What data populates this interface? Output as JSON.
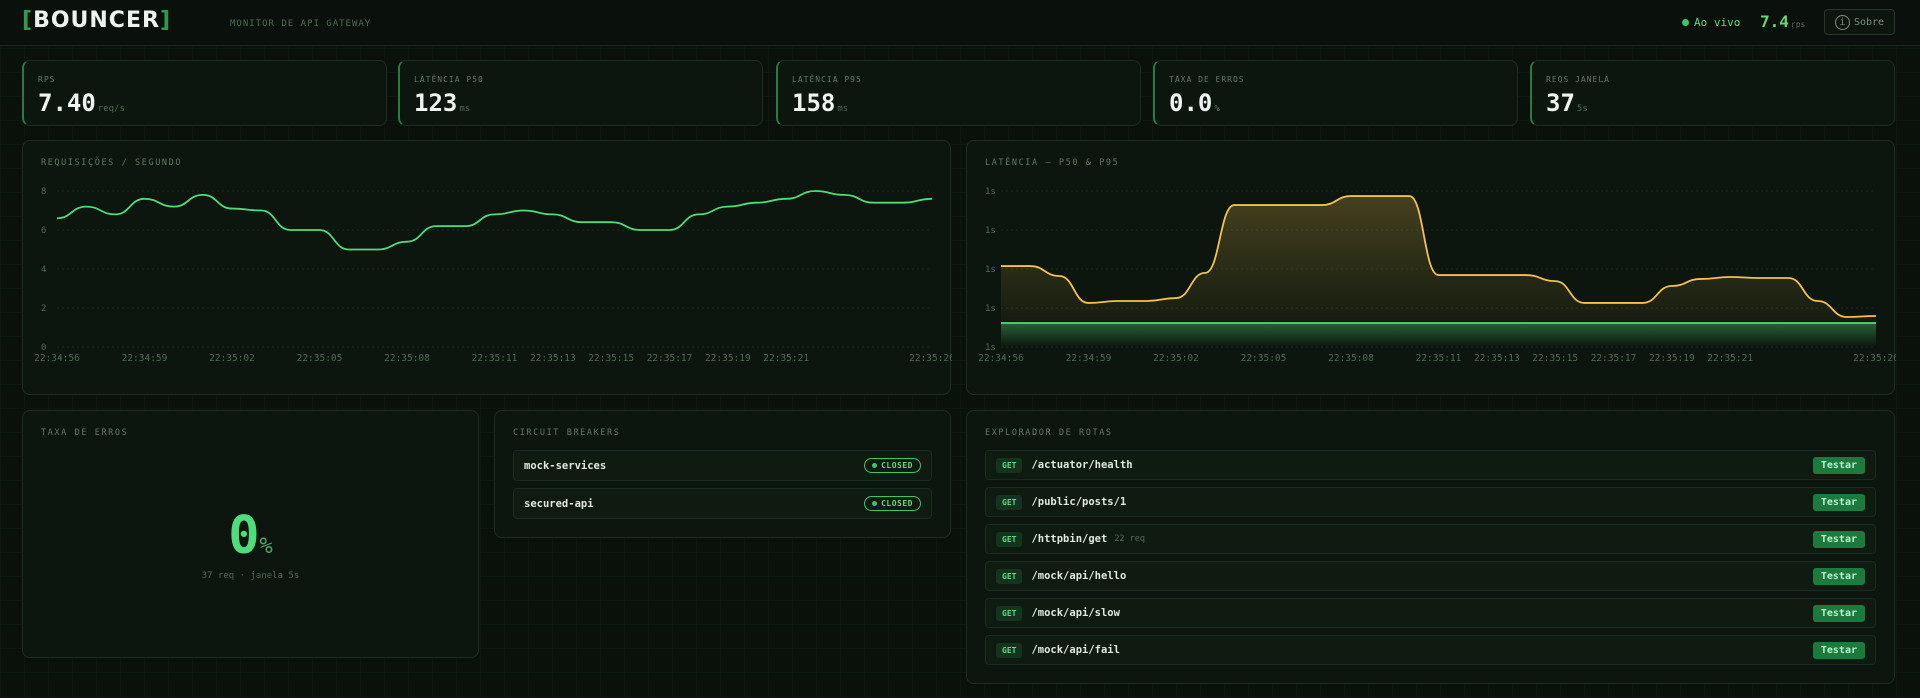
{
  "header": {
    "brand": "BOUNCER",
    "subtitle": "MONITOR DE API GATEWAY",
    "live_label": "Ao vivo",
    "rps_value": "7.4",
    "rps_unit": "rps",
    "about_label": "Sobre"
  },
  "kpis": [
    {
      "label": "RPS",
      "value": "7.40",
      "unit": "req/s"
    },
    {
      "label": "LATÊNCIA P50",
      "value": "123",
      "unit": "ms"
    },
    {
      "label": "LATÊNCIA P95",
      "value": "158",
      "unit": "ms"
    },
    {
      "label": "TAXA DE ERROS",
      "value": "0.0",
      "unit": "%"
    },
    {
      "label": "REQS JANELA",
      "value": "37",
      "unit": "5s"
    }
  ],
  "chart_data": [
    {
      "type": "line",
      "title": "REQUISIÇÕES / SEGUNDO",
      "ylim": [
        0,
        8
      ],
      "yticks": [
        "0",
        "2",
        "4",
        "6",
        "8"
      ],
      "xticks": [
        "22:34:56",
        "22:34:59",
        "22:35:02",
        "22:35:05",
        "22:35:08",
        "22:35:11",
        "22:35:13",
        "22:35:15",
        "22:35:17",
        "22:35:19",
        "22:35:21",
        "22:35:26"
      ],
      "x_start": "22:34:56",
      "x_end": "22:35:26",
      "grid": true,
      "color": "#4fdc7c",
      "values": [
        6.6,
        7.2,
        6.8,
        7.6,
        7.2,
        7.8,
        7.1,
        7.0,
        6.0,
        6.0,
        5.0,
        5.0,
        5.4,
        6.2,
        6.2,
        6.8,
        7.0,
        6.8,
        6.4,
        6.4,
        6.0,
        6.0,
        6.8,
        7.2,
        7.4,
        7.6,
        8.0,
        7.8,
        7.4,
        7.4,
        7.6
      ]
    },
    {
      "type": "area",
      "title": "LATÊNCIA — P50 & P95",
      "ylim": [
        0,
        800
      ],
      "yticks": [
        "1s",
        "1s",
        "1s",
        "1s",
        "1s"
      ],
      "xticks": [
        "22:34:56",
        "22:34:59",
        "22:35:02",
        "22:35:05",
        "22:35:08",
        "22:35:11",
        "22:35:13",
        "22:35:15",
        "22:35:17",
        "22:35:19",
        "22:35:21",
        "22:35:26"
      ],
      "x_start": "22:34:56",
      "x_end": "22:35:26",
      "grid": true,
      "series": [
        {
          "color": "#f2c14e",
          "values": [
            415,
            415,
            364,
            226,
            236,
            236,
            251,
            380,
            728,
            728,
            728,
            728,
            774,
            774,
            774,
            369,
            369,
            369,
            369,
            338,
            226,
            226,
            226,
            313,
            349,
            359,
            354,
            354,
            236,
            154,
            159
          ]
        },
        {
          "color": "#4fdc7c",
          "values": [
            123,
            123,
            123,
            123,
            123,
            123,
            123,
            123,
            123,
            123,
            123,
            123,
            123,
            123,
            123,
            123,
            123,
            123,
            123,
            123,
            123,
            123,
            123,
            123,
            123,
            123,
            123,
            123,
            123,
            123,
            123
          ]
        }
      ]
    }
  ],
  "errors": {
    "title": "TAXA DE ERROS",
    "value": "0",
    "unit": "%",
    "subtitle": "37 req · janela 5s"
  },
  "breakers": {
    "title": "CIRCUIT BREAKERS",
    "items": [
      {
        "name": "mock-services",
        "state": "CLOSED"
      },
      {
        "name": "secured-api",
        "state": "CLOSED"
      }
    ]
  },
  "routes": {
    "title": "EXPLORADOR DE ROTAS",
    "button_label": "Testar",
    "items": [
      {
        "method": "GET",
        "path": "/actuator/health",
        "count": ""
      },
      {
        "method": "GET",
        "path": "/public/posts/1",
        "count": ""
      },
      {
        "method": "GET",
        "path": "/httpbin/get",
        "count": "22 req"
      },
      {
        "method": "GET",
        "path": "/mock/api/hello",
        "count": ""
      },
      {
        "method": "GET",
        "path": "/mock/api/slow",
        "count": ""
      },
      {
        "method": "GET",
        "path": "/mock/api/fail",
        "count": ""
      }
    ]
  }
}
